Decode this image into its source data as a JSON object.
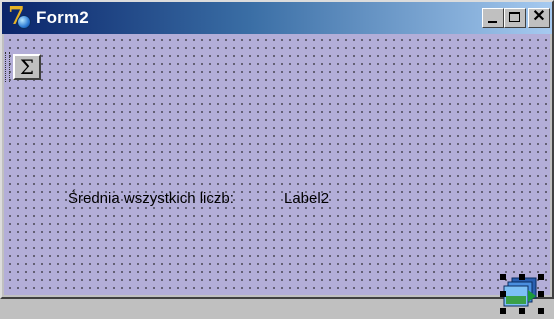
{
  "window": {
    "title": "Form2"
  },
  "toolbar": {
    "sigma_button_label": "Σ"
  },
  "labels": {
    "average_caption": "Średnia wszystkich liczb:",
    "average_value": "Label2"
  },
  "titlebar_buttons": {
    "minimize": "_",
    "maximize": "□",
    "close": "✕"
  }
}
